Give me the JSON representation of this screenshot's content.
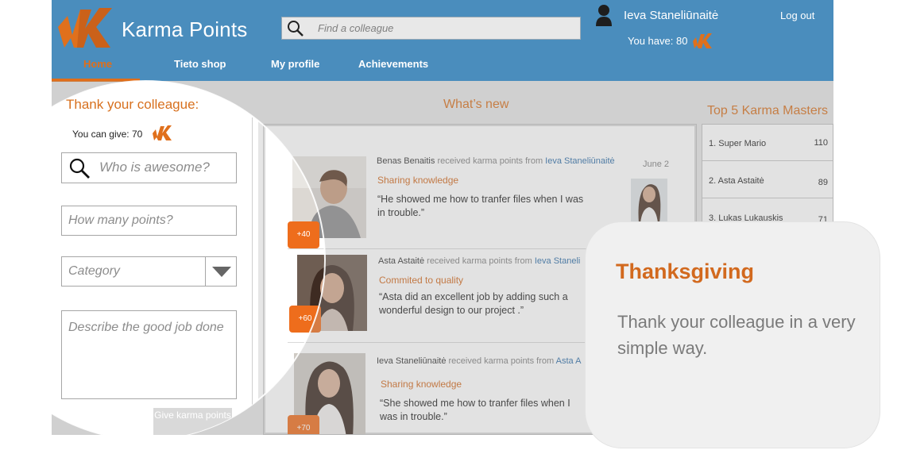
{
  "app": {
    "title": "Karma Points",
    "logo_letter": "K"
  },
  "search": {
    "placeholder": "Find a colleague"
  },
  "user": {
    "name": "Ieva Stanelіūnaitė",
    "logout_label": "Log out",
    "balance_text": "You have: 80"
  },
  "nav": {
    "items": [
      {
        "label": "Home",
        "active": true
      },
      {
        "label": "Tieto shop"
      },
      {
        "label": "My profile"
      },
      {
        "label": "Achievements"
      }
    ]
  },
  "give_panel": {
    "title": "Thank your colleague:",
    "can_give_text": "You can give: 70",
    "who_placeholder": "Who is awesome?",
    "points_placeholder": "How many points?",
    "category_placeholder": "Category",
    "describe_placeholder": "Describe the good job done",
    "button_label": "Give karma points"
  },
  "feed": {
    "title": "What’s new",
    "items": [
      {
        "receiver": "Benas Benaitis",
        "verb": " received karma points from ",
        "giver": "Ieva Staneliūnaitė",
        "category": "Sharing knowledge",
        "quote": "“He showed me how to tranfer files when I was in trouble.”",
        "points": "+40",
        "date": "June 2"
      },
      {
        "receiver": "Asta Astaitė",
        "verb": " received karma points from ",
        "giver": "Ieva Staneli",
        "category": "Commited to quality",
        "quote": "“Asta did an excellent job by adding such a wonderful design to our project .”",
        "points": "+60"
      },
      {
        "receiver": "Ieva Staneliūnaitė",
        "verb": " received karma points from ",
        "giver": "Asta A",
        "category": "Sharing knowledge",
        "quote": "“She showed me how to tranfer files when I was in trouble.”",
        "points": "+70"
      }
    ]
  },
  "top5": {
    "title": "Top 5 Karma Masters",
    "rows": [
      {
        "name": "1.  Super Mario",
        "points": "110"
      },
      {
        "name": "2.  Asta Astaitė",
        "points": "89"
      },
      {
        "name": "3.  Lukas Lukauskis",
        "points": "71"
      }
    ]
  },
  "callout": {
    "title": "Thanksgiving",
    "text": "Thank your colleague in a very simple way."
  },
  "colors": {
    "header_blue": "#4a8dbd",
    "accent_orange": "#d7701e",
    "badge_orange": "#ee6d1c",
    "link_blue": "#2f6ea8"
  }
}
